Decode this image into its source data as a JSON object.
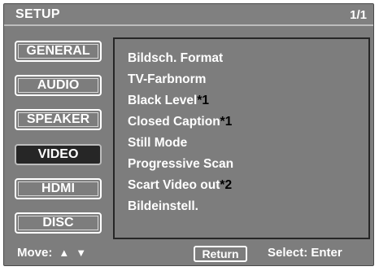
{
  "header": {
    "title": "SETUP",
    "page": "1/1"
  },
  "tabs": [
    {
      "label": "GENERAL",
      "active": false
    },
    {
      "label": "AUDIO",
      "active": false
    },
    {
      "label": "SPEAKER",
      "active": false
    },
    {
      "label": "VIDEO",
      "active": true
    },
    {
      "label": "HDMI",
      "active": false
    },
    {
      "label": "DISC",
      "active": false
    }
  ],
  "menu": [
    {
      "label": "Bildsch. Format",
      "note": ""
    },
    {
      "label": "TV-Farbnorm",
      "note": ""
    },
    {
      "label": "Black Level",
      "note": "*1"
    },
    {
      "label": "Closed Caption",
      "note": "*1"
    },
    {
      "label": "Still Mode",
      "note": ""
    },
    {
      "label": "Progressive Scan",
      "note": ""
    },
    {
      "label": "Scart Video out",
      "note": "*2"
    },
    {
      "label": "Bildeinstell.",
      "note": ""
    }
  ],
  "footer": {
    "move_label": "Move:",
    "up_arrow": "▲",
    "down_arrow": "▼",
    "return_label": "Return",
    "select_label": "Select: Enter"
  }
}
